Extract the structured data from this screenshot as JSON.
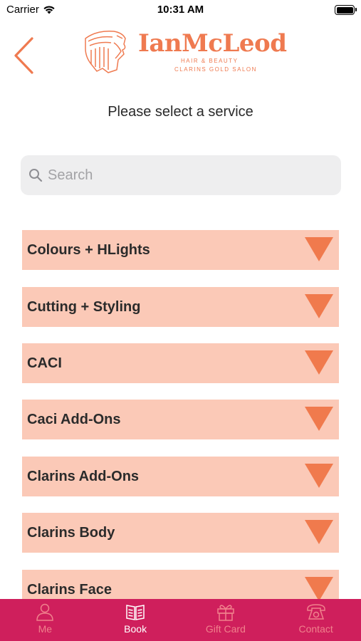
{
  "status_bar": {
    "carrier": "Carrier",
    "time": "10:31 AM"
  },
  "header": {
    "logo_name": "IanMcLeod",
    "logo_subtitle_1": "HAIR & BEAUTY",
    "logo_subtitle_2": "CLARINS GOLD SALON"
  },
  "page_title": "Please select a service",
  "search": {
    "placeholder": "Search",
    "value": ""
  },
  "services": [
    {
      "label": "Colours + HLights"
    },
    {
      "label": "Cutting + Styling"
    },
    {
      "label": "CACI"
    },
    {
      "label": "Caci Add-Ons"
    },
    {
      "label": "Clarins Add-Ons"
    },
    {
      "label": "Clarins Body"
    },
    {
      "label": "Clarins Face"
    }
  ],
  "tabs": [
    {
      "label": "Me",
      "icon": "person-icon",
      "active": false
    },
    {
      "label": "Book",
      "icon": "book-icon",
      "active": true
    },
    {
      "label": "Gift Card",
      "icon": "gift-icon",
      "active": false
    },
    {
      "label": "Contact",
      "icon": "phone-icon",
      "active": false
    }
  ],
  "colors": {
    "accent": "#ef7a50",
    "row_background": "#fbc9b7",
    "tab_bar": "#cf1f5c",
    "tab_inactive": "#f0818c",
    "tab_active": "#ffffff"
  }
}
